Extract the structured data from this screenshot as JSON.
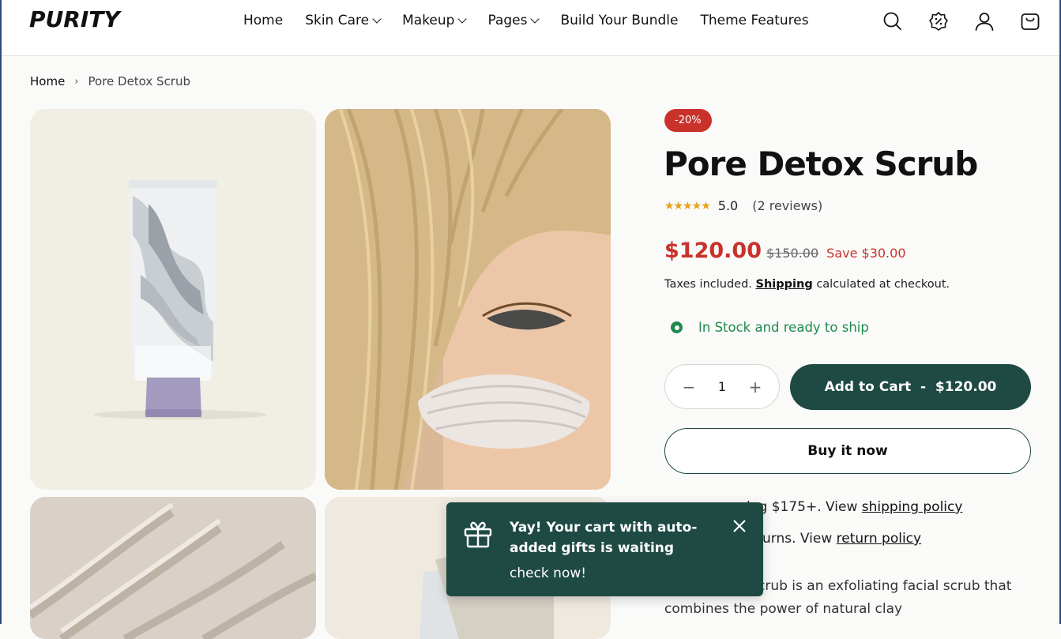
{
  "header": {
    "logo": "PURITY",
    "nav": [
      {
        "label": "Home",
        "has_dropdown": false
      },
      {
        "label": "Skin Care",
        "has_dropdown": true
      },
      {
        "label": "Makeup",
        "has_dropdown": true
      },
      {
        "label": "Pages",
        "has_dropdown": true
      },
      {
        "label": "Build Your Bundle",
        "has_dropdown": false
      },
      {
        "label": "Theme Features",
        "has_dropdown": false
      }
    ],
    "icons": [
      "search-icon",
      "discount-icon",
      "account-icon",
      "cart-icon"
    ]
  },
  "breadcrumb": {
    "home": "Home",
    "separator": "›",
    "current": "Pore Detox Scrub"
  },
  "product": {
    "badge": "-20%",
    "title": "Pore Detox Scrub",
    "stars": "★★★★★",
    "rating": "5.0",
    "reviews": "(2 reviews)",
    "price": "$120.00",
    "compare_price": "$150.00",
    "savings": "Save $30.00",
    "tax_prefix": "Taxes included.",
    "shipping_link": "Shipping",
    "tax_suffix": "calculated at checkout.",
    "stock": "In Stock and ready to ship",
    "quantity": "1",
    "minus": "−",
    "plus": "+",
    "add_to_cart": "Add to Cart  -  $120.00",
    "buy_now": "Buy it now",
    "policy1_text": "ing $175+. View",
    "policy1_link": "shipping policy",
    "policy2_text": "urns. View",
    "policy2_link": "return policy",
    "description": "crub is an exfoliating facial scrub that combines the power of natural clay"
  },
  "toast": {
    "message": "Yay! Your cart with auto-added gifts is waiting",
    "link": "check now!"
  },
  "colors": {
    "accent_green": "#1e4a43",
    "sale_red": "#c8322b",
    "stock_green": "#1f8a4c"
  }
}
